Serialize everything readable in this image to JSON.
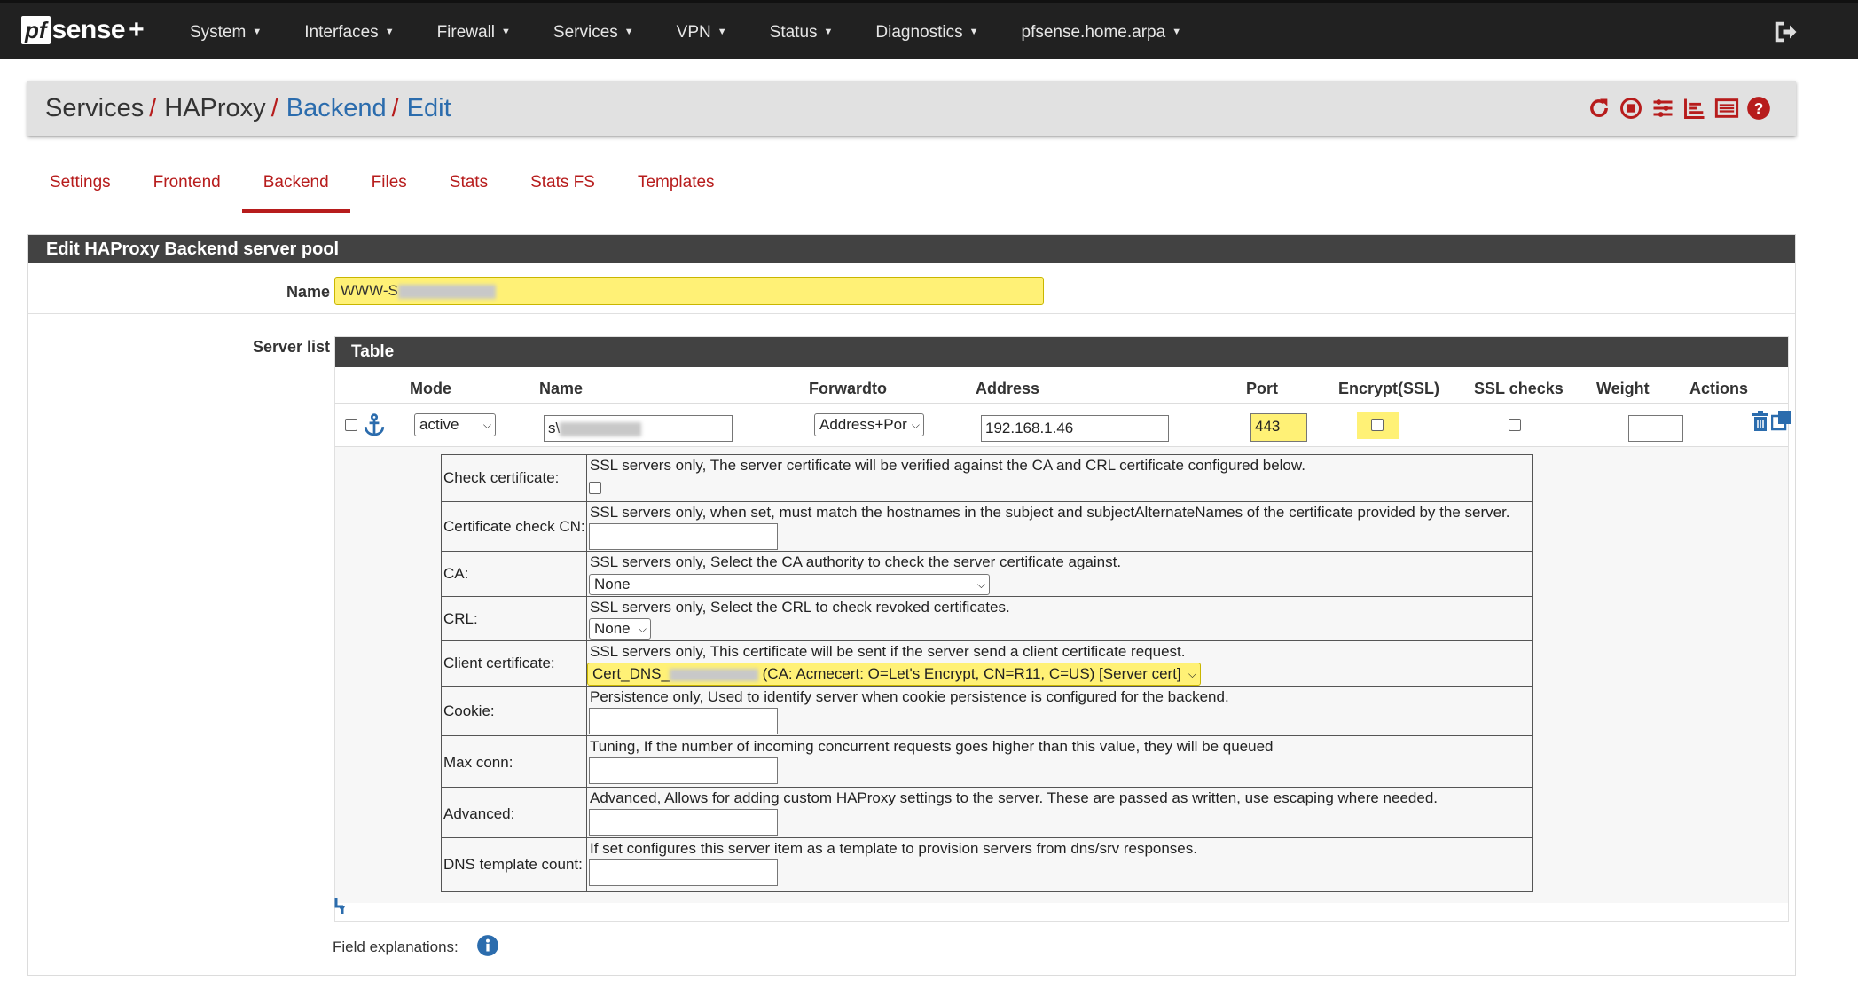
{
  "brand": {
    "pf": "pf",
    "sense": "sense",
    "plus": "+"
  },
  "nav": {
    "items": [
      "System",
      "Interfaces",
      "Firewall",
      "Services",
      "VPN",
      "Status",
      "Diagnostics",
      "pfsense.home.arpa"
    ]
  },
  "breadcrumb": {
    "services": "Services",
    "haproxy": "HAProxy",
    "backend": "Backend",
    "edit": "Edit",
    "sep": "/"
  },
  "tabs": [
    "Settings",
    "Frontend",
    "Backend",
    "Files",
    "Stats",
    "Stats FS",
    "Templates"
  ],
  "panel": {
    "title": "Edit HAProxy Backend server pool",
    "name_label": "Name",
    "name_value_prefix": "WWW-S",
    "server_list_label": "Server list",
    "table_title": "Table"
  },
  "columns": {
    "mode": "Mode",
    "name": "Name",
    "forwardto": "Forwardto",
    "address": "Address",
    "port": "Port",
    "encrypt": "Encrypt(SSL)",
    "ssl_checks": "SSL checks",
    "weight": "Weight",
    "actions": "Actions"
  },
  "server": {
    "mode": "active",
    "name_prefix": "s\\",
    "forwardto": "Address+Por",
    "address": "192.168.1.46",
    "port": "443",
    "weight": ""
  },
  "details": {
    "check_cert_label": "Check certificate:",
    "check_cert_desc": "SSL servers only, The server certificate will be verified against the CA and CRL certificate configured below.",
    "cn_label": "Certificate check CN:",
    "cn_desc": "SSL servers only, when set, must match the hostnames in the subject and subjectAlternateNames of the certificate provided by the server.",
    "ca_label": "CA:",
    "ca_desc": "SSL servers only, Select the CA authority to check the server certificate against.",
    "ca_value": "None",
    "crl_label": "CRL:",
    "crl_desc": "SSL servers only, Select the CRL to check revoked certificates.",
    "crl_value": "None",
    "client_cert_label": "Client certificate:",
    "client_cert_desc": "SSL servers only, This certificate will be sent if the server send a client certificate request.",
    "client_cert_prefix": "Cert_DNS_",
    "client_cert_suffix": " (CA: Acmecert: O=Let's Encrypt, CN=R11, C=US) [Server cert]",
    "cookie_label": "Cookie:",
    "cookie_desc": "Persistence only, Used to identify server when cookie persistence is configured for the backend.",
    "maxconn_label": "Max conn:",
    "maxconn_desc": "Tuning, If the number of incoming concurrent requests goes higher than this value, they will be queued",
    "advanced_label": "Advanced:",
    "advanced_desc": "Advanced, Allows for adding custom HAProxy settings to the server. These are passed as written, use escaping where needed.",
    "dns_label": "DNS template count:",
    "dns_desc": "If set configures this server item as a template to provision servers from dns/srv responses."
  },
  "footer": {
    "field_explanations": "Field explanations:"
  },
  "colors": {
    "navbar": "#212121",
    "accent_red": "#b71c1c",
    "link_blue": "#2b6cad",
    "highlight": "#fff176",
    "panel_header": "#424242"
  }
}
